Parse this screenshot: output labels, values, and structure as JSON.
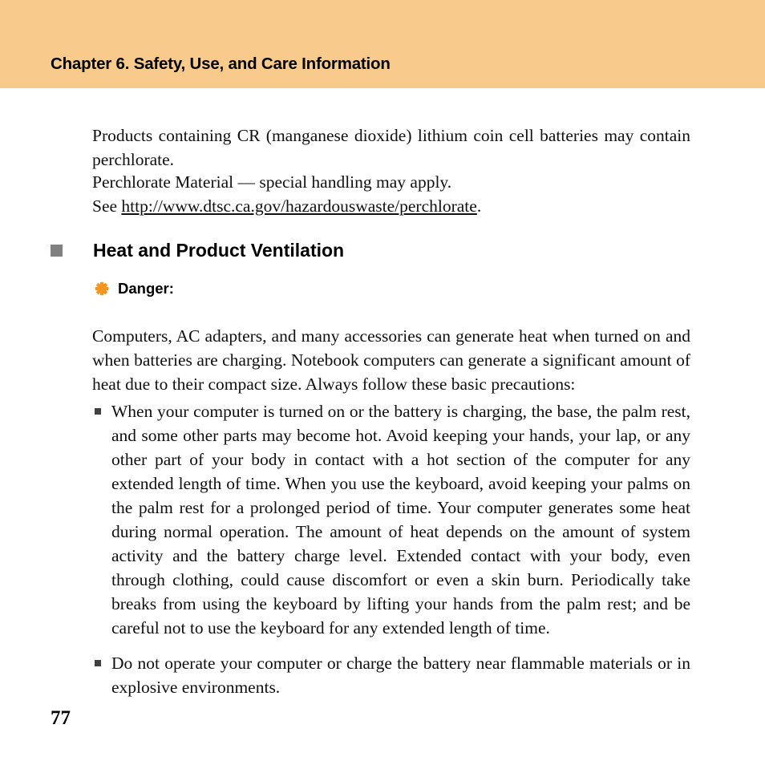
{
  "header": {
    "title": "Chapter 6. Safety, Use, and Care Information",
    "band_color": "#f8cb8c"
  },
  "body": {
    "intro_paragraph": "Products containing CR (manganese dioxide) lithium coin cell batteries may contain perchlorate.",
    "perchlorate_line1": "Perchlorate Material — special handling may apply.",
    "perchlorate_see_prefix": "See ",
    "perchlorate_url": "http://www.dtsc.ca.gov/hazardouswaste/perchlorate",
    "perchlorate_suffix": ".",
    "section_heading": "Heat and Product Ventilation",
    "section_bullet_color": "#808080",
    "danger_label": "Danger:",
    "danger_icon_color": "#f7941e",
    "danger_icon_name": "asterisk-burst-icon",
    "danger_paragraph": "Computers, AC adapters, and many accessories can generate heat when turned on and when batteries are charging. Notebook computers can generate a significant amount of heat due to their compact size. Always follow these basic precautions:",
    "bullets": [
      "When your computer is turned on or the battery is charging, the base, the palm rest, and some other parts may become hot. Avoid keeping your hands, your lap, or any other part of your body in contact with a hot section of the computer for any extended length of time. When you use the keyboard, avoid keeping your palms on the palm rest for a prolonged period of time. Your computer generates some heat during normal operation. The amount of heat depends on the amount of system activity and the battery charge level. Extended contact with your body, even through clothing, could cause discomfort or even a skin burn. Periodically take breaks from using the keyboard by lifting your hands from the palm rest; and be careful not to use the keyboard for any extended length of time.",
      "Do not operate your computer or charge the battery near flammable materials or in explosive environments."
    ]
  },
  "footer": {
    "page_number": "77"
  }
}
